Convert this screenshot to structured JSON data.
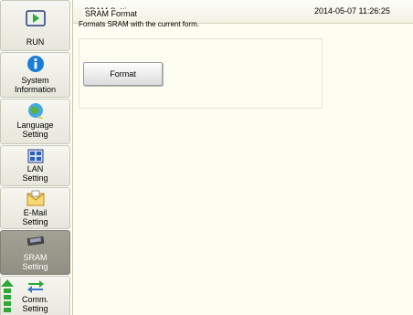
{
  "header": {
    "title": "SRAM Setting",
    "datetime": "2014-05-07  11:26:25"
  },
  "sidebar": {
    "items": [
      {
        "label": "RUN",
        "icon": "run-icon",
        "active": false
      },
      {
        "label": "System\nInformation",
        "icon": "info-icon",
        "active": false
      },
      {
        "label": "Language\nSetting",
        "icon": "language-icon",
        "active": false
      },
      {
        "label": "LAN\nSetting",
        "icon": "lan-icon",
        "active": false
      },
      {
        "label": "E-Mail\nSetting",
        "icon": "email-icon",
        "active": false
      },
      {
        "label": "SRAM\nSetting",
        "icon": "sram-icon",
        "active": true
      },
      {
        "label": "Comm.\nSetting",
        "icon": "comm-icon",
        "active": false
      }
    ]
  },
  "sram_format": {
    "group_title": "SRAM Format",
    "description": "Formats SRAM with the current form.",
    "button_label": "Format"
  },
  "colors": {
    "accent_active": "#8f8f83",
    "info_blue": "#1a7ed8",
    "scroll_green": "#2ea836",
    "content_bg": "#fdfdf1"
  }
}
